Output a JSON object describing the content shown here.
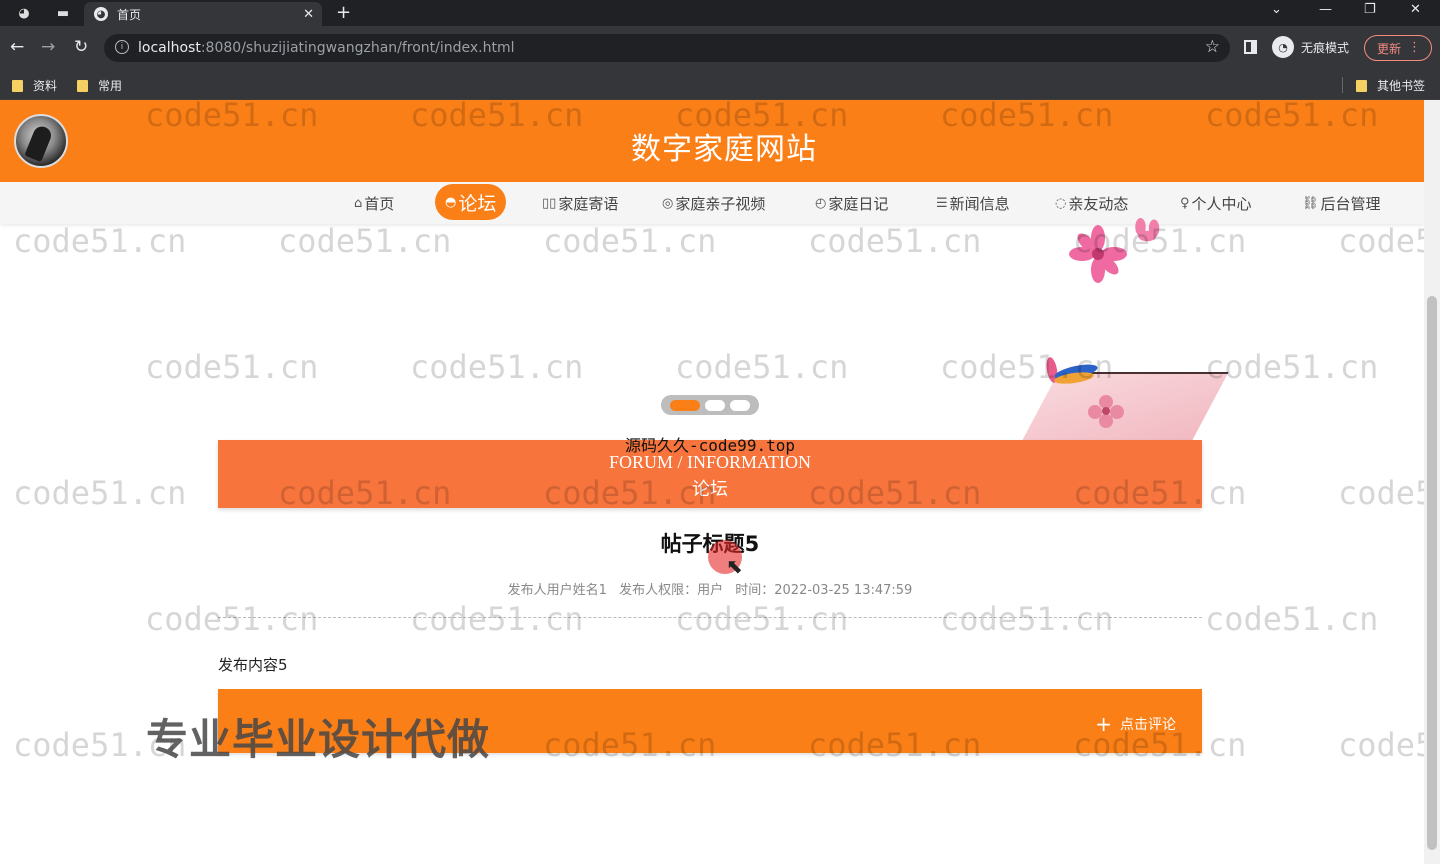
{
  "browser": {
    "tab_title": "首页",
    "url_host": "localhost",
    "url_rest": ":8080/shuzijiatingwangzhan/front/index.html",
    "incognito_label": "无痕模式",
    "update_label": "更新",
    "bookmarks": [
      "资料",
      "常用"
    ],
    "other_bookmarks": "其他书签"
  },
  "site": {
    "title": "数字家庭网站",
    "nav": [
      {
        "icon": "⌂",
        "label": "首页"
      },
      {
        "icon": "◓",
        "label": "论坛"
      },
      {
        "icon": "▯▯",
        "label": "家庭寄语"
      },
      {
        "icon": "◎",
        "label": "家庭亲子视频"
      },
      {
        "icon": "◴",
        "label": "家庭日记"
      },
      {
        "icon": "☰",
        "label": "新闻信息"
      },
      {
        "icon": "◌",
        "label": "亲友动态"
      },
      {
        "icon": "♀",
        "label": "个人中心"
      },
      {
        "icon": "⛓",
        "label": "后台管理"
      }
    ],
    "active_nav": "论坛"
  },
  "overlay": {
    "source_text": "源码久久-code99.top",
    "ad_text": "专业毕业设计代做",
    "watermark": "code51.cn"
  },
  "section": {
    "en": "FORUM / INFORMATION",
    "cn": "论坛"
  },
  "post": {
    "title": "帖子标题5",
    "author": "发布人用户姓名1",
    "role": "发布人权限：用户",
    "time": "时间：2022-03-25 13:47:59",
    "content": "发布内容5"
  },
  "comment": {
    "button_label": "点击评论"
  },
  "colors": {
    "accent": "#fb7f17",
    "section_bar": "#f7743c"
  }
}
